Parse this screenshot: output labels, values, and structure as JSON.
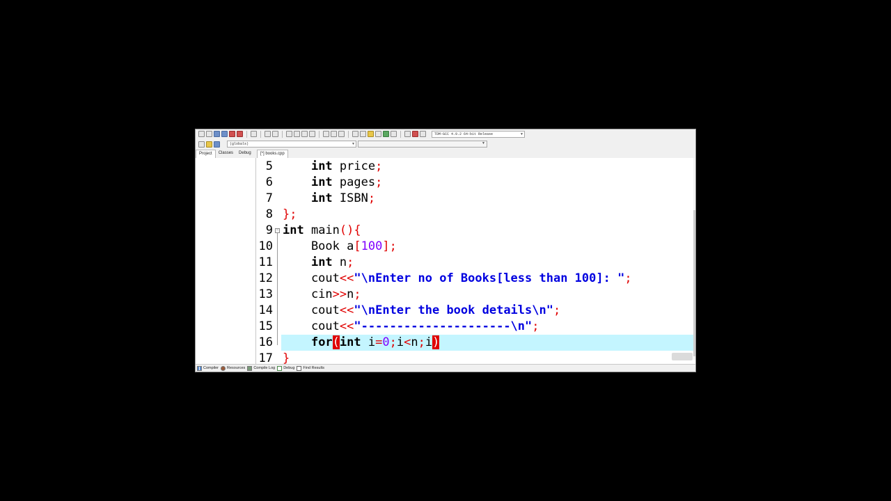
{
  "toolbar": {
    "compiler": "TDM-GCC 4.9.2 64-bit Release"
  },
  "scope": {
    "value": "(globals)"
  },
  "left_tabs": [
    "Project",
    "Classes",
    "Debug"
  ],
  "editor": {
    "file_tab": "[*] books.cpp",
    "lines": [
      {
        "num": "5",
        "code": "    int price;"
      },
      {
        "num": "6",
        "code": "    int pages;"
      },
      {
        "num": "7",
        "code": "    int ISBN;"
      },
      {
        "num": "8",
        "code": "};"
      },
      {
        "num": "9",
        "code": "int main(){"
      },
      {
        "num": "10",
        "code": "    Book a[100];"
      },
      {
        "num": "11",
        "code": "    int n;"
      },
      {
        "num": "12",
        "code": "    cout<<\"\\nEnter no of Books[less than 100]: \";"
      },
      {
        "num": "13",
        "code": "    cin>>n;"
      },
      {
        "num": "14",
        "code": "    cout<<\"\\nEnter the book details\\n\";"
      },
      {
        "num": "15",
        "code": "    cout<<\"---------------------\\n\";"
      },
      {
        "num": "16",
        "code": "    for(int i=0;i<n;i)"
      },
      {
        "num": "17",
        "code": "}"
      }
    ],
    "current_line": "16"
  },
  "bottom_tabs": [
    "Compiler",
    "Resources",
    "Compile Log",
    "Debug",
    "Find Results"
  ],
  "colors": {
    "current_line_bg": "#c4f5ff",
    "symbol": "#e00000",
    "number": "#8000ff",
    "string": "#0000e0"
  }
}
